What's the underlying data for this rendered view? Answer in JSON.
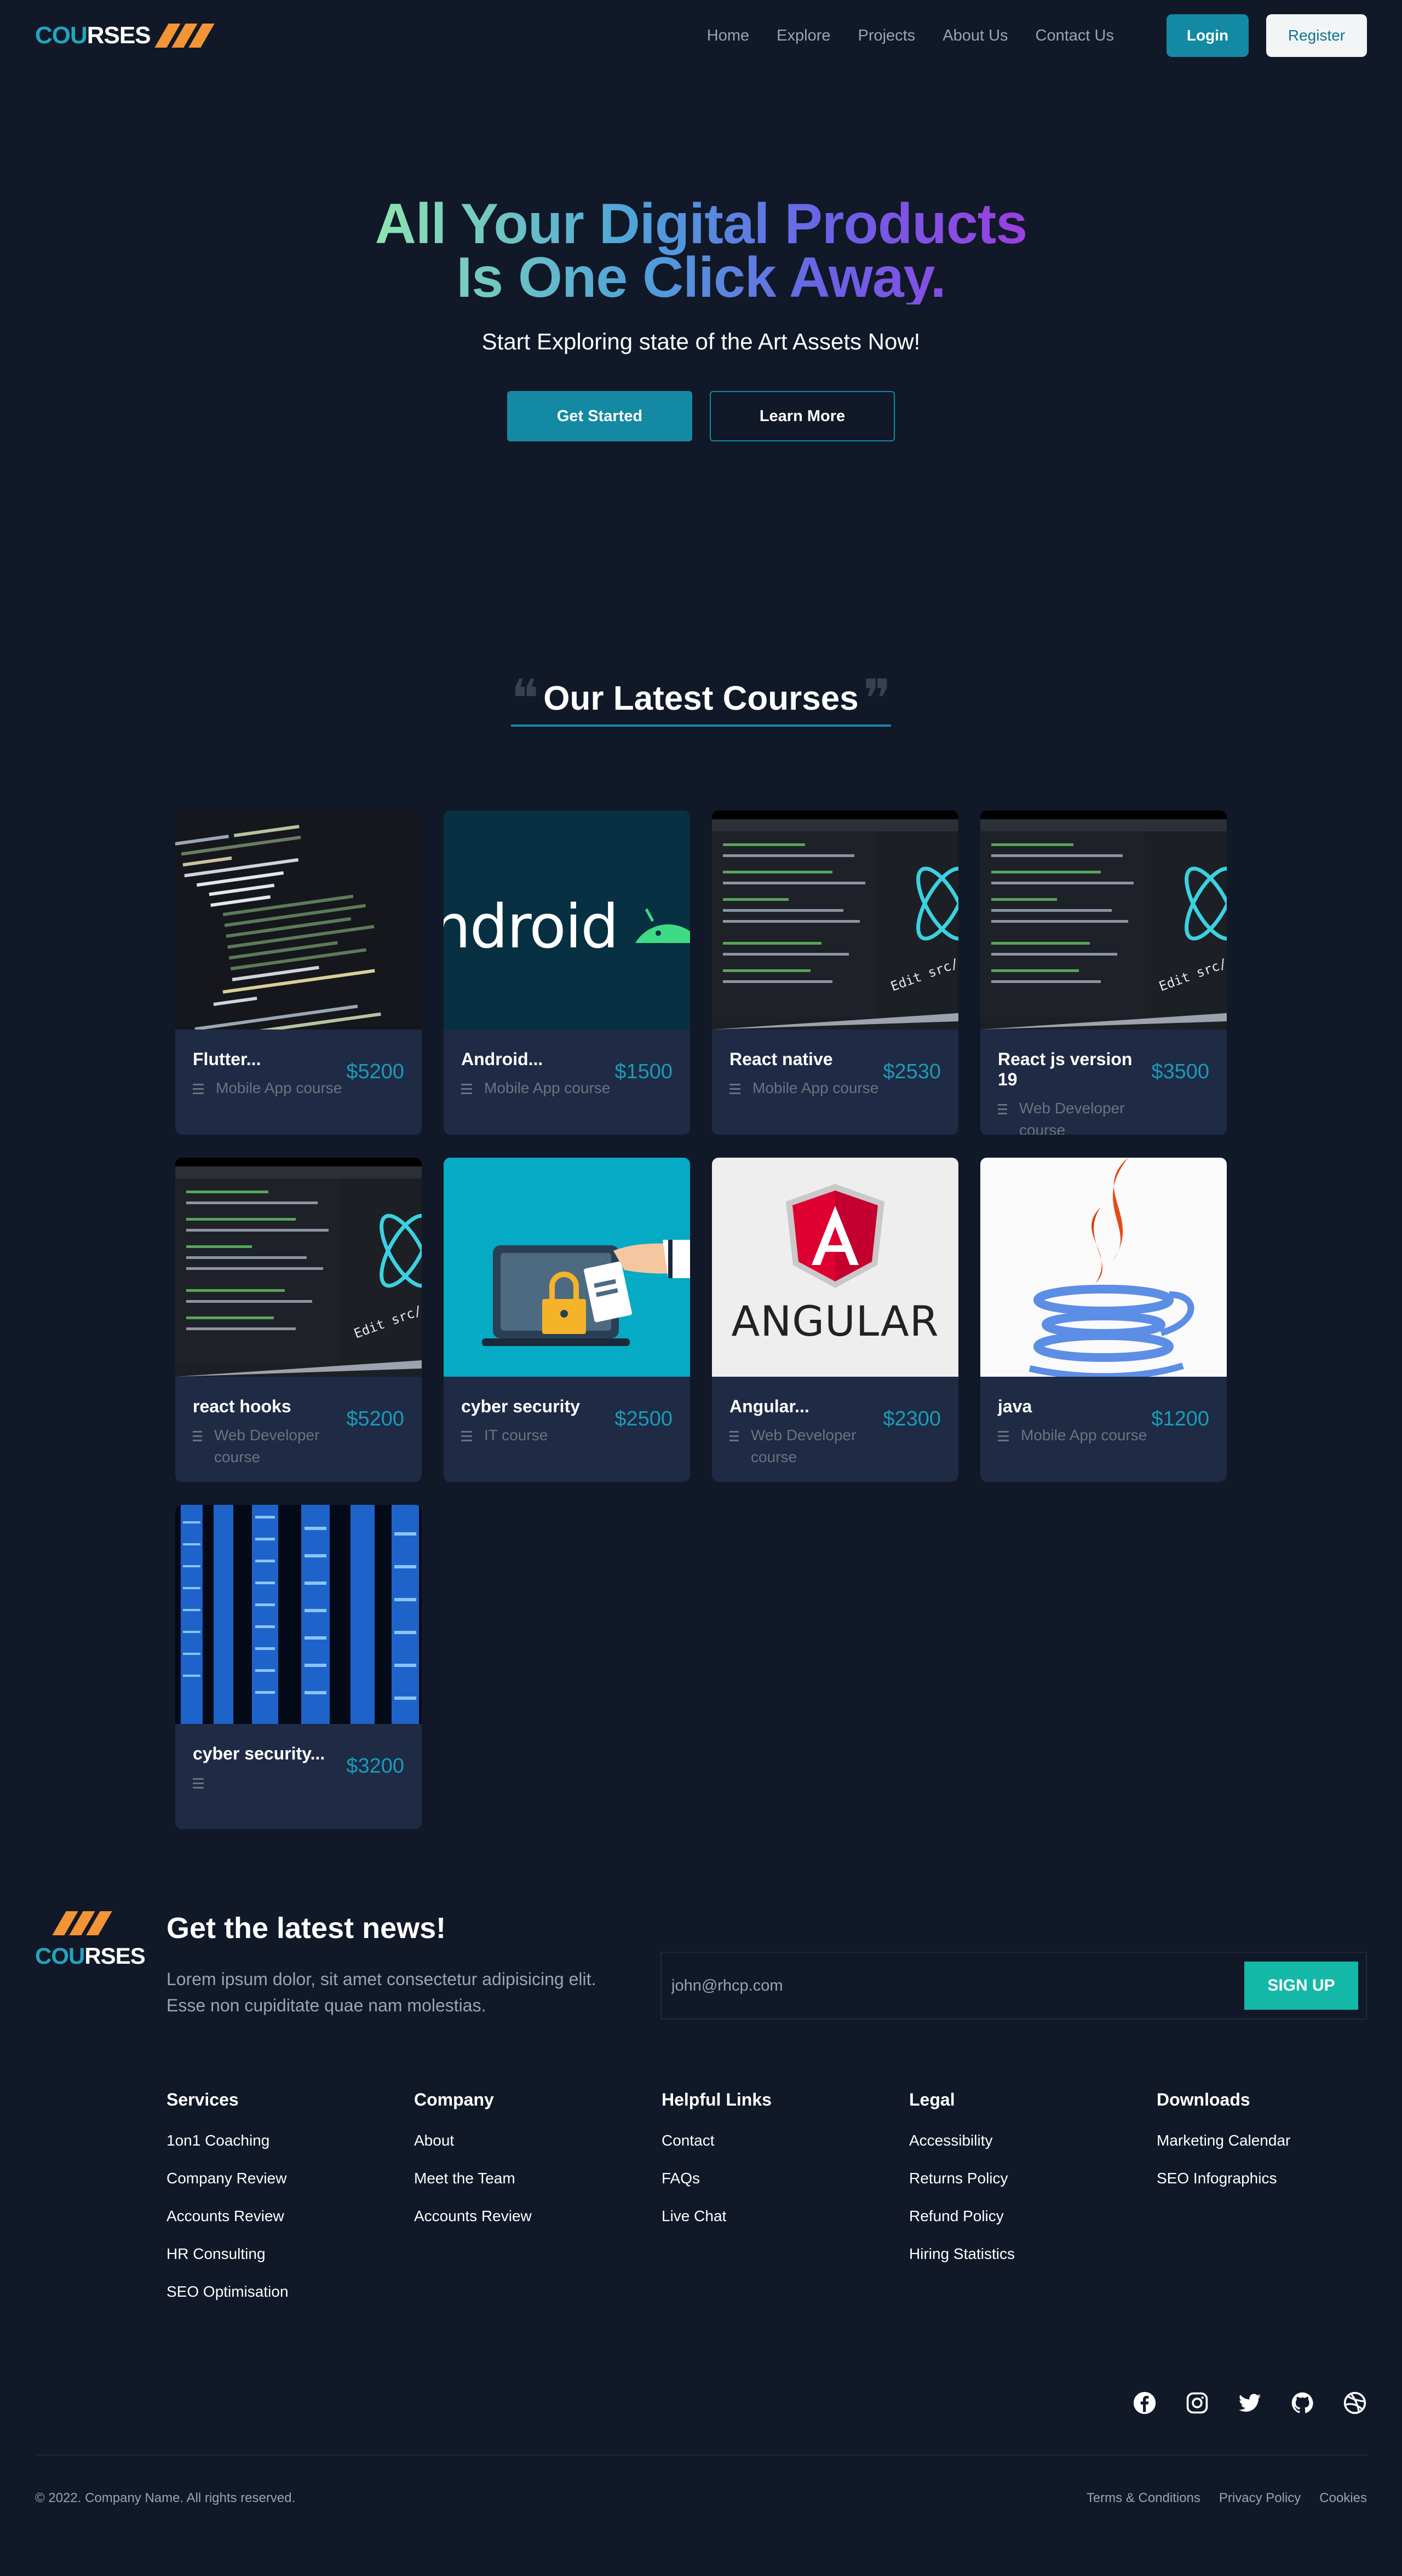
{
  "header": {
    "logo_accent": "COU",
    "logo_rest": "RSES",
    "nav": [
      "Home",
      "Explore",
      "Projects",
      "About Us",
      "Contact Us"
    ],
    "login": "Login",
    "register": "Register"
  },
  "hero": {
    "title_line1": "All Your Digital Products",
    "title_line2": "Is One Click Away.",
    "subtitle": "Start Exploring state of the Art Assets Now!",
    "primary_cta": "Get Started",
    "secondary_cta": "Learn More"
  },
  "courses": {
    "section_title": "Our Latest Courses",
    "items": [
      {
        "title": "Flutter...",
        "category": "Mobile App course",
        "price": "$5200",
        "image": "flutter-code"
      },
      {
        "title": "Android...",
        "category": "Mobile App course",
        "price": "$1500",
        "image": "android-logo",
        "image_text": "ndroid"
      },
      {
        "title": "React native",
        "category": "Mobile App course",
        "price": "$2530",
        "image": "react-editor"
      },
      {
        "title": "React js version 19",
        "category": "Web Developer course",
        "price": "$3500",
        "image": "react-editor"
      },
      {
        "title": "react hooks",
        "category": "Web Developer course",
        "price": "$5200",
        "image": "react-editor"
      },
      {
        "title": "cyber security",
        "category": "IT course",
        "price": "$2500",
        "image": "laptop-lock"
      },
      {
        "title": "Angular...",
        "category": "Web Developer course",
        "price": "$2300",
        "image": "angular-logo",
        "image_text": "ANGULAR"
      },
      {
        "title": "java",
        "category": "Mobile App course",
        "price": "$1200",
        "image": "java-logo"
      },
      {
        "title": "cyber security...",
        "category": "",
        "price": "$3200",
        "image": "server-racks"
      }
    ]
  },
  "newsletter": {
    "title": "Get the latest news!",
    "text": "Lorem ipsum dolor, sit amet consectetur adipisicing elit. Esse non cupiditate quae nam molestias.",
    "email_value": "john@rhcp.com",
    "button": "SIGN UP"
  },
  "footer": {
    "columns": [
      {
        "title": "Services",
        "links": [
          "1on1 Coaching",
          "Company Review",
          "Accounts Review",
          "HR Consulting",
          "SEO Optimisation"
        ]
      },
      {
        "title": "Company",
        "links": [
          "About",
          "Meet the Team",
          "Accounts Review"
        ]
      },
      {
        "title": "Helpful Links",
        "links": [
          "Contact",
          "FAQs",
          "Live Chat"
        ]
      },
      {
        "title": "Legal",
        "links": [
          "Accessibility",
          "Returns Policy",
          "Refund Policy",
          "Hiring Statistics"
        ]
      },
      {
        "title": "Downloads",
        "links": [
          "Marketing Calendar",
          "SEO Infographics"
        ]
      }
    ],
    "socials": [
      "facebook-icon",
      "instagram-icon",
      "twitter-icon",
      "github-icon",
      "dribbble-icon"
    ],
    "copyright": "© 2022. Company Name. All rights reserved.",
    "legal_links": [
      "Terms & Conditions",
      "Privacy Policy",
      "Cookies"
    ]
  },
  "colors": {
    "background": "#111827",
    "accent": "#1489a3",
    "card": "#1f2a44",
    "price": "#1a9bb8",
    "signup": "#14b8a6",
    "logo_stripes": "#f39436"
  }
}
